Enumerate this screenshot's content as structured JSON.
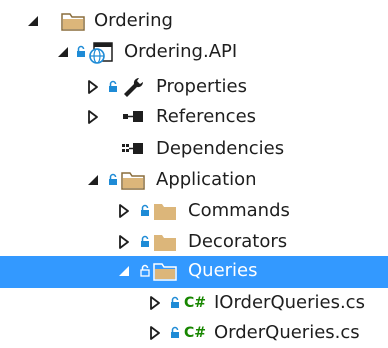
{
  "colors": {
    "folder_fill": "#DCB67A",
    "folder_dark": "#C9A062",
    "lock_blue": "#1E8BD6",
    "csharp_green": "#178600",
    "selection": "#3399FF",
    "arrow": "#1E1E1E"
  },
  "tree": {
    "items": [
      {
        "label": "Ordering",
        "icon": "solution-folder-icon",
        "expanded": true
      },
      {
        "label": "Ordering.API",
        "icon": "web-project-icon",
        "expanded": true
      },
      {
        "label": "Properties",
        "icon": "wrench-icon",
        "expanded": false
      },
      {
        "label": "References",
        "icon": "references-icon",
        "expanded": false
      },
      {
        "label": "Dependencies",
        "icon": "dependencies-icon"
      },
      {
        "label": "Application",
        "icon": "folder-icon",
        "expanded": true
      },
      {
        "label": "Commands",
        "icon": "folder-icon",
        "expanded": false
      },
      {
        "label": "Decorators",
        "icon": "folder-icon",
        "expanded": false
      },
      {
        "label": "Queries",
        "icon": "open-folder-icon",
        "expanded": true,
        "selected": true
      },
      {
        "label": "IOrderQueries.cs",
        "icon": "csharp-file-icon",
        "expanded": false
      },
      {
        "label": "OrderQueries.cs",
        "icon": "csharp-file-icon",
        "expanded": false
      }
    ]
  }
}
